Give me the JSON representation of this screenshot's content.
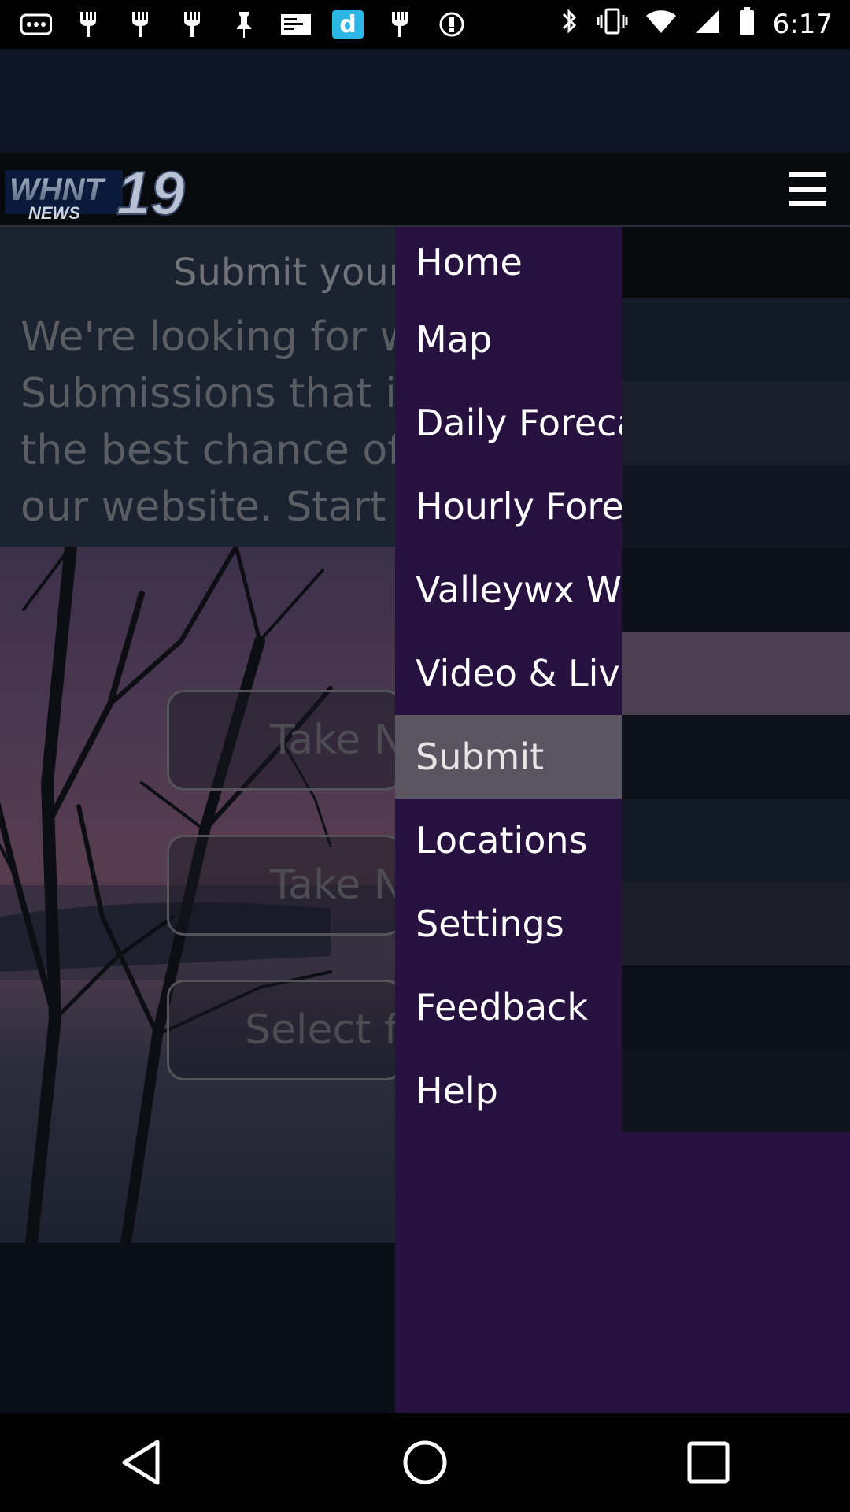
{
  "status_bar": {
    "time": "6:17",
    "left_icons": [
      "more-icon",
      "fork-icon",
      "fork-icon",
      "fork-icon",
      "pin-icon",
      "mail-icon",
      "d-app-icon",
      "fork-icon",
      "alert-icon"
    ],
    "right_icons": [
      "bluetooth-icon",
      "vibrate-icon",
      "wifi-icon",
      "signal-icon",
      "battery-icon"
    ]
  },
  "header": {
    "logo_text": "WHNT19",
    "logo_sub": "NEWS"
  },
  "page": {
    "intro_title": "Submit your",
    "intro_lines": [
      "We're looking for we",
      "Submissions that in",
      "the best chance of b",
      "our website. Start sh"
    ],
    "buttons": [
      "Take N",
      "Take N",
      "Select fr"
    ]
  },
  "drawer": {
    "items": [
      {
        "label": "Home",
        "tail_color": "#07090d"
      },
      {
        "label": "Map",
        "tail_color": "#121a26"
      },
      {
        "label": "Daily Forecast",
        "tail_color": "#181e2a"
      },
      {
        "label": "Hourly Forecast",
        "tail_color": "#101721"
      },
      {
        "label": "Valleywx Weather",
        "tail_color": "#0b0f17"
      },
      {
        "label": "Video & Live",
        "tail_color": "#4b3f50"
      },
      {
        "label": "Submit",
        "tail_color": "#0c111a",
        "active": true
      },
      {
        "label": "Locations",
        "tail_color": "#121a24"
      },
      {
        "label": "Settings",
        "tail_color": "#1c1f28"
      },
      {
        "label": "Feedback",
        "tail_color": "#0b0f17"
      },
      {
        "label": "Help",
        "tail_color": "#0f141d"
      }
    ]
  },
  "nav_bar": {
    "buttons": [
      "back-icon",
      "home-icon",
      "recents-icon"
    ]
  }
}
